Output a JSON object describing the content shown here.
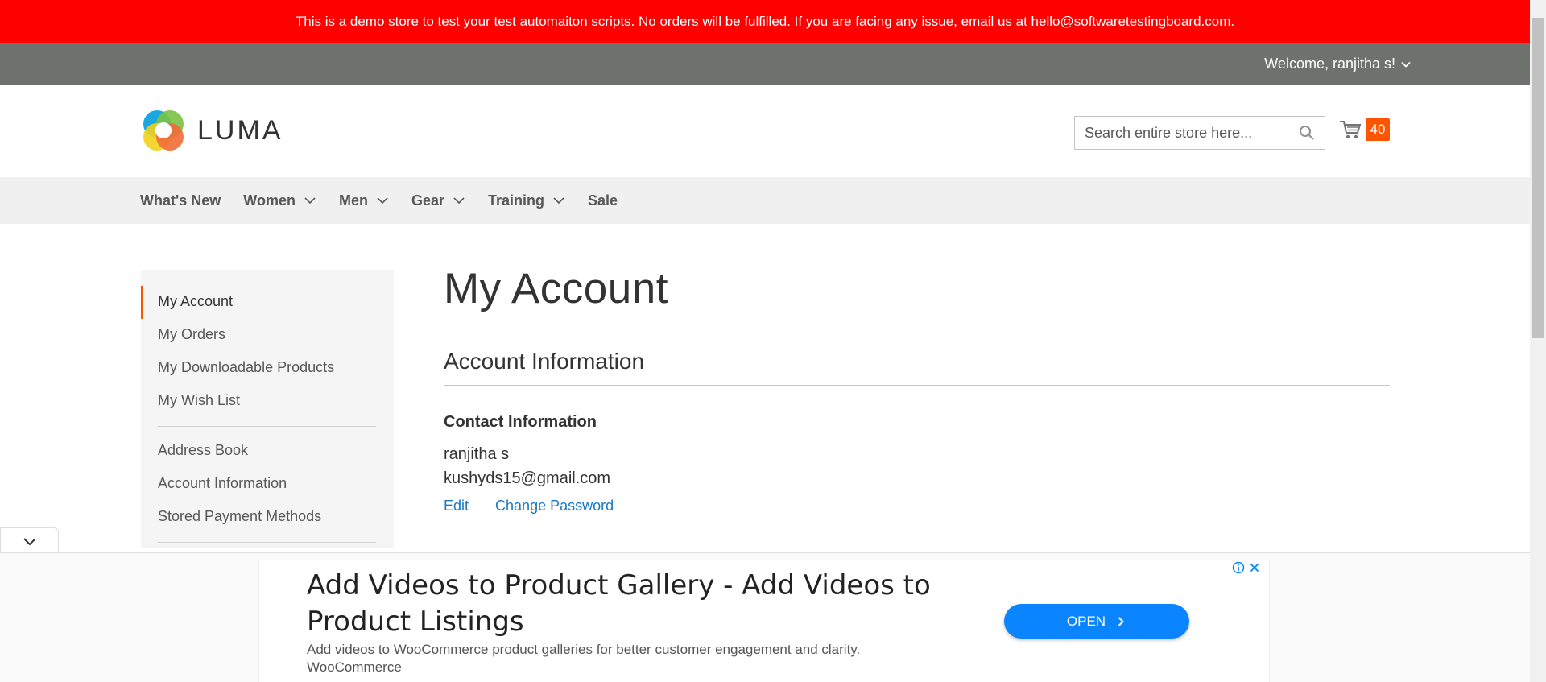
{
  "banner": {
    "text": "This is a demo store to test your test automaiton scripts. No orders will be fulfilled. If you are facing any issue, email us at hello@softwaretestingboard.com."
  },
  "top_bar": {
    "welcome": "Welcome, ranjitha s!"
  },
  "header": {
    "logo_text": "LUMA",
    "search_placeholder": "Search entire store here...",
    "cart_count": "40"
  },
  "nav": {
    "items": [
      {
        "label": "What's New",
        "has_dropdown": false
      },
      {
        "label": "Women",
        "has_dropdown": true
      },
      {
        "label": "Men",
        "has_dropdown": true
      },
      {
        "label": "Gear",
        "has_dropdown": true
      },
      {
        "label": "Training",
        "has_dropdown": true
      },
      {
        "label": "Sale",
        "has_dropdown": false
      }
    ]
  },
  "sidebar": {
    "group1": [
      "My Account",
      "My Orders",
      "My Downloadable Products",
      "My Wish List"
    ],
    "group2": [
      "Address Book",
      "Account Information",
      "Stored Payment Methods"
    ]
  },
  "main": {
    "title": "My Account",
    "section_title": "Account Information",
    "contact_title": "Contact Information",
    "name": "ranjitha s",
    "email": "kushyds15@gmail.com",
    "edit_label": "Edit",
    "change_password_label": "Change Password"
  },
  "ad": {
    "headline": "Add Videos to Product Gallery - Add Videos to Product Listings",
    "description": "Add videos to WooCommerce product galleries for better customer engagement and clarity.",
    "brand": "WooCommerce",
    "cta": "OPEN"
  },
  "colors": {
    "banner": "#ff0000",
    "top_bar": "#6e716e",
    "accent": "#ff5501",
    "link": "#1979c3",
    "ad_button": "#0a85ff"
  }
}
